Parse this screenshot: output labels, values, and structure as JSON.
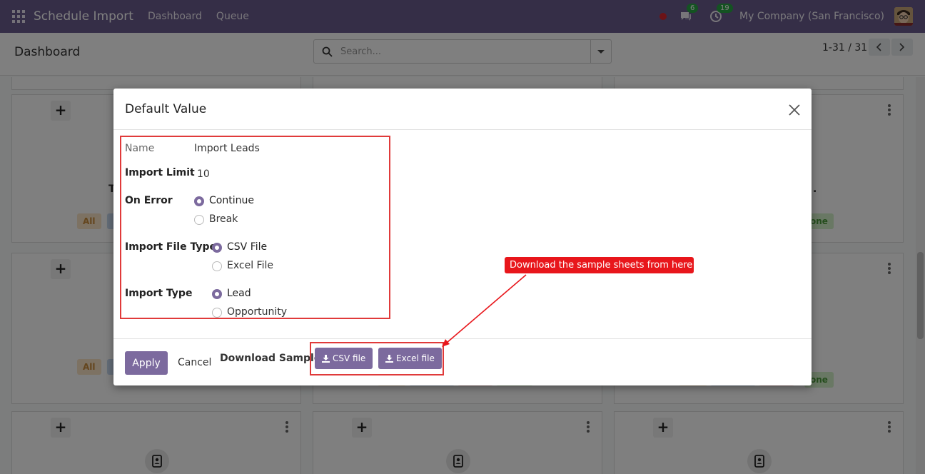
{
  "navbar": {
    "brand": "Schedule Import",
    "menu": [
      "Dashboard",
      "Queue"
    ],
    "messages_badge": "6",
    "activities_badge": "19",
    "company": "My Company (San Francisco)"
  },
  "control": {
    "breadcrumb": "Dashboard",
    "search_placeholder": "Search...",
    "pager": "1-31 / 31"
  },
  "cards": {
    "tag_all": "All",
    "tag_done_partial": "one",
    "title_fragment_left": "T",
    "title_fragment_right": "."
  },
  "modal": {
    "title": "Default Value",
    "fields": {
      "name_label": "Name",
      "name_value": "Import Leads",
      "limit_label": "Import Limit",
      "limit_value": "10",
      "on_error_label": "On Error",
      "on_error_options": [
        "Continue",
        "Break"
      ],
      "file_type_label": "Import File Type",
      "file_type_options": [
        "CSV File",
        "Excel File"
      ],
      "import_type_label": "Import Type",
      "import_type_options": [
        "Lead",
        "Opportunity"
      ]
    },
    "footer": {
      "apply": "Apply",
      "cancel": "Cancel",
      "download_label": "Download Sample:",
      "csv_button": "CSV file",
      "excel_button": "Excel file"
    }
  },
  "callout": {
    "text": "Download the sample sheets from here"
  },
  "colors": {
    "navbar": "#6b5c8f",
    "primary": "#7c6a9e",
    "highlight": "#e03a3a",
    "callout": "#e8161b"
  }
}
